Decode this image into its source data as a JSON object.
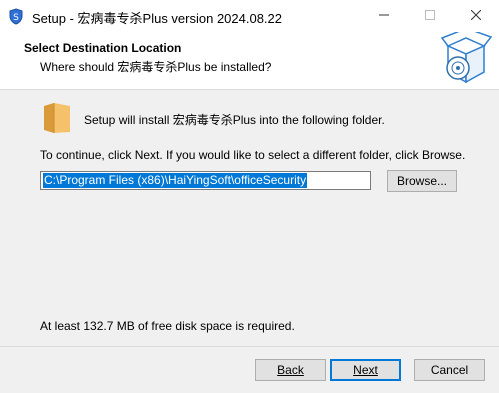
{
  "window": {
    "title": "Setup - 宏病毒专杀Plus version 2024.08.22",
    "icon": "setup-shield-icon",
    "controls": {
      "minimize": "minimize-icon",
      "maximize": "maximize-icon",
      "close": "close-icon"
    }
  },
  "header": {
    "title": "Select Destination Location",
    "subtitle": "Where should 宏病毒专杀Plus be installed?",
    "icon": "wizard-box-icon"
  },
  "main": {
    "install_message": "Setup will install 宏病毒专杀Plus into the following folder.",
    "continue_message": "To continue, click Next. If you would like to select a different folder, click Browse.",
    "install_path": "C:\\Program Files (x86)\\HaiYingSoft\\officeSecurity",
    "browse_label": "Browse...",
    "disk_space_message": "At least 132.7 MB of free disk space is required."
  },
  "footer": {
    "back_label": "Back",
    "next_label": "Next",
    "cancel_label": "Cancel"
  },
  "colors": {
    "selection": "#0078d7",
    "panel": "#f0f0f0",
    "button": "#e1e1e1",
    "folder": "#f5c26b"
  }
}
